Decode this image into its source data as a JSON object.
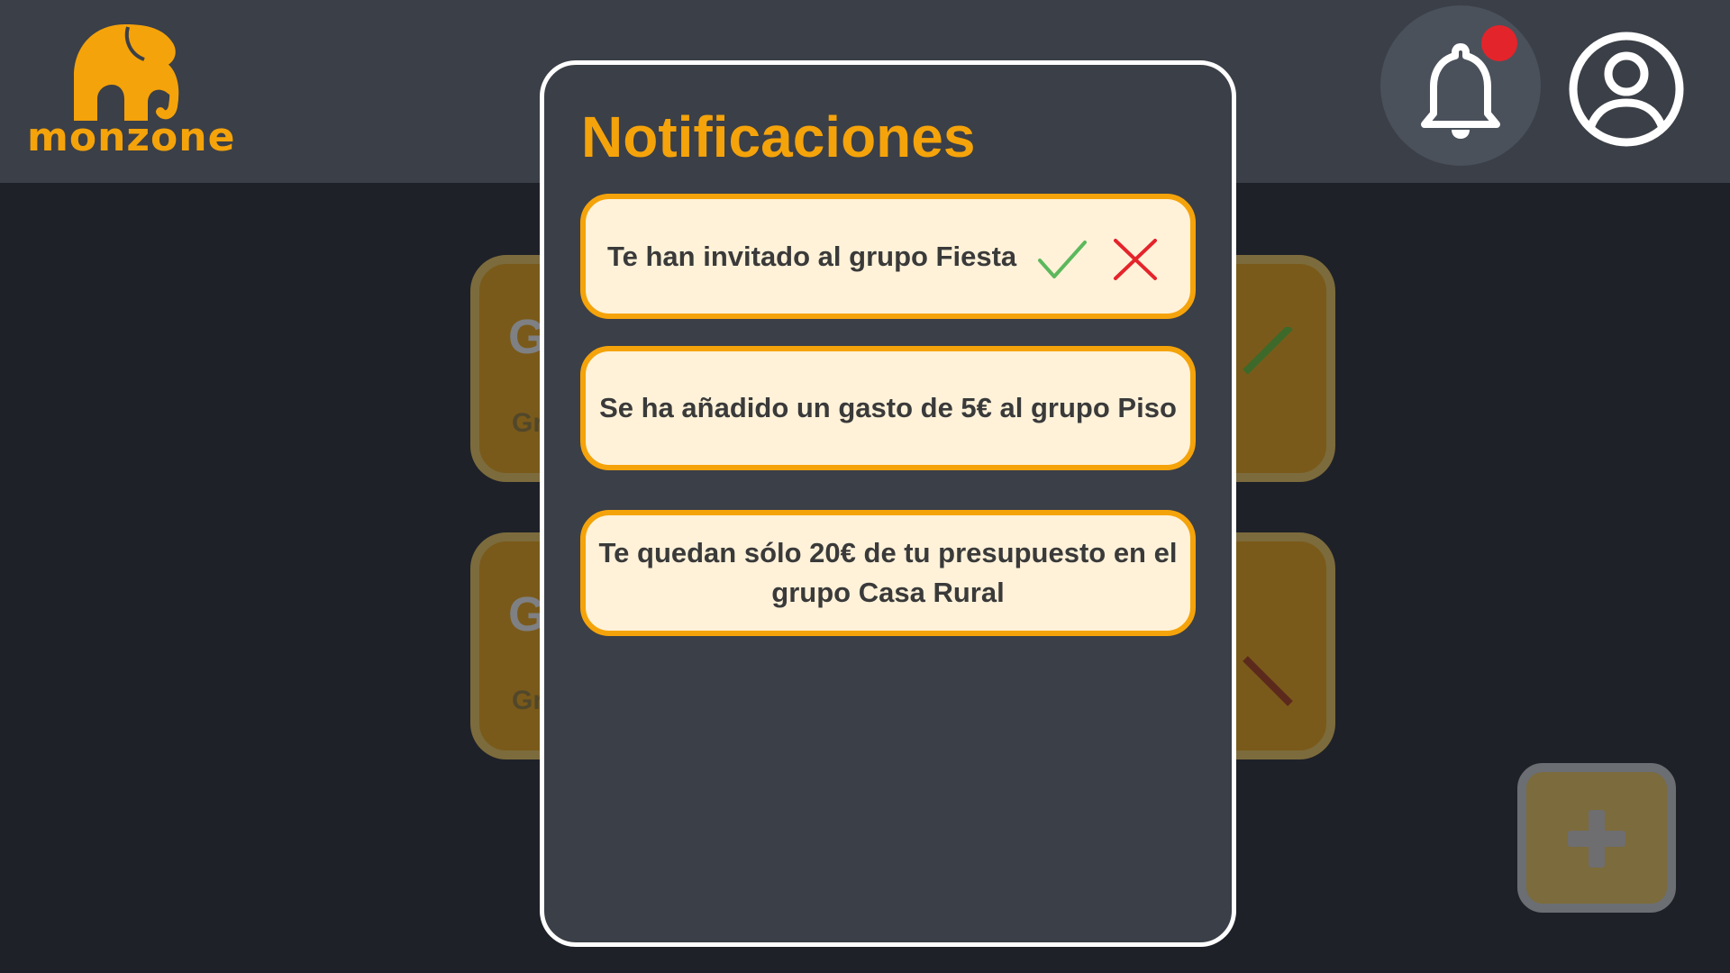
{
  "app": {
    "logo_text": "monzone",
    "brand_color": "#f5a30a"
  },
  "header": {
    "notifications_icon": "bell-icon",
    "has_unread": true,
    "profile_icon": "user-circle-icon"
  },
  "background_groups": [
    {
      "title": "G",
      "subtitle": "Gr",
      "mark": "check-icon"
    },
    {
      "title": "G",
      "subtitle": "Gr",
      "mark": "cross-icon"
    }
  ],
  "fab": {
    "icon": "plus-icon"
  },
  "modal": {
    "title": "Notificaciones",
    "notifications": [
      {
        "text": "Te han invitado al grupo Fiesta",
        "actions": [
          "accept-check-icon",
          "reject-cross-icon"
        ]
      },
      {
        "text": "Se ha añadido un gasto de 5€ al grupo Piso"
      },
      {
        "text": "Te quedan sólo 20€ de tu presupuesto en el grupo Casa Rural"
      }
    ]
  },
  "colors": {
    "accent": "#f5a30a",
    "card_bg": "#fff2d9",
    "accept": "#5cb85c",
    "reject": "#e4242b",
    "badge": "#e4242b"
  }
}
